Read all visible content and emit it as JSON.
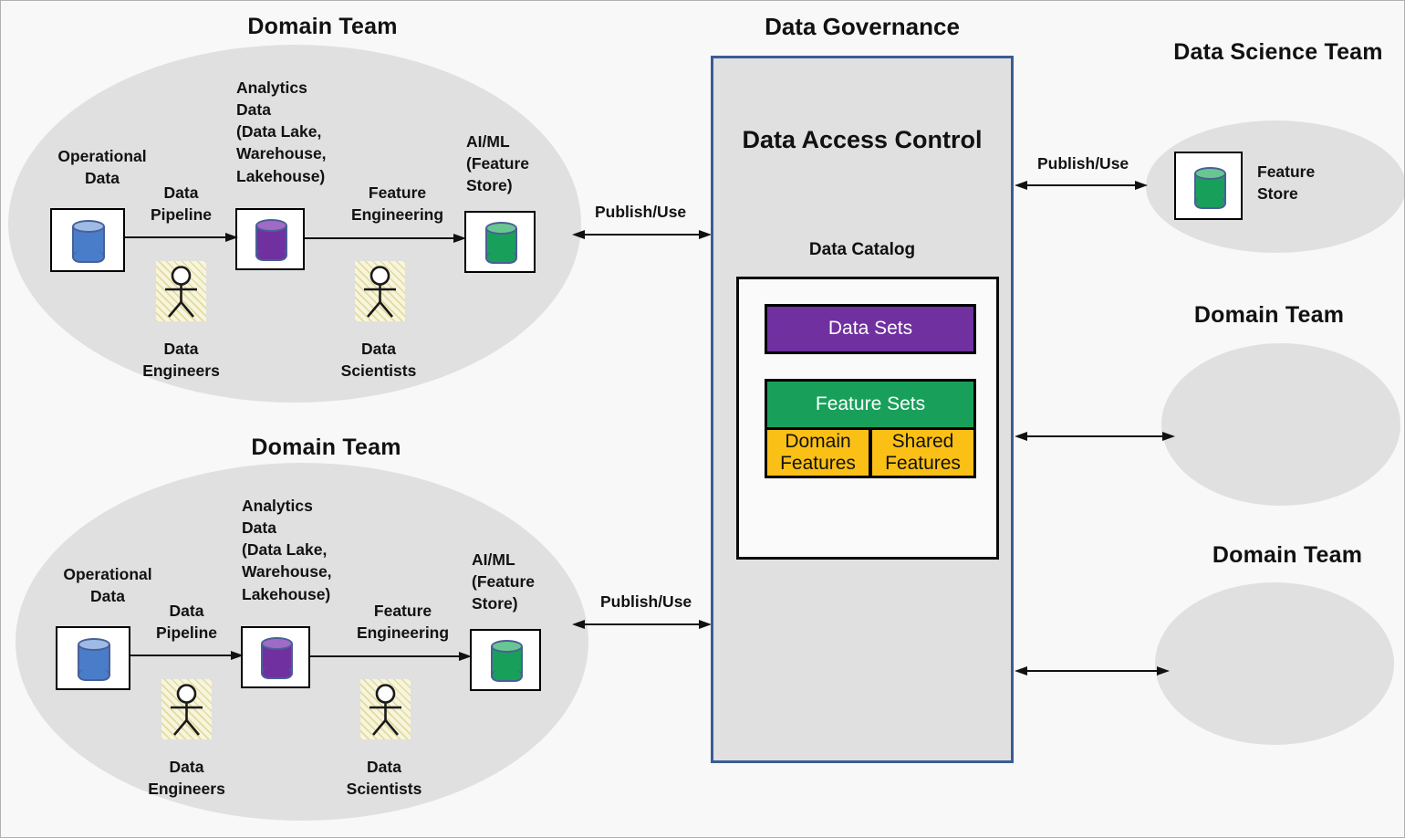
{
  "groups": {
    "domain_team_top": {
      "title": "Domain Team",
      "operational_data": "Operational\nData",
      "analytics_data": "Analytics\nData\n(Data Lake,\nWarehouse,\nLakehouse)",
      "aiml": "AI/ML\n(Feature\nStore)",
      "data_pipeline": "Data\nPipeline",
      "feature_engineering": "Feature\nEngineering",
      "data_engineers": "Data\nEngineers",
      "data_scientists": "Data\nScientists"
    },
    "domain_team_bottom": {
      "title": "Domain Team",
      "operational_data": "Operational\nData",
      "analytics_data": "Analytics\nData\n(Data Lake,\nWarehouse,\nLakehouse)",
      "aiml": "AI/ML\n(Feature\nStore)",
      "data_pipeline": "Data\nPipeline",
      "feature_engineering": "Feature\nEngineering",
      "data_engineers": "Data\nEngineers",
      "data_scientists": "Data\nScientists"
    },
    "data_science_team": {
      "title": "Data Science Team",
      "feature_store": "Feature\nStore"
    },
    "domain_team_right_1": {
      "title": "Domain Team"
    },
    "domain_team_right_2": {
      "title": "Domain Team"
    }
  },
  "governance": {
    "title": "Data Governance",
    "access_control": "Data Access Control",
    "catalog": "Data Catalog",
    "chips": {
      "data_sets": "Data Sets",
      "feature_sets": "Feature Sets",
      "domain_features": "Domain\nFeatures",
      "shared_features": "Shared\nFeatures"
    }
  },
  "connectors": {
    "publish_use_top": "Publish/Use",
    "publish_use_bottom": "Publish/Use",
    "publish_use_ds": "Publish/Use"
  },
  "colors": {
    "operational_db": "#4a7dc9",
    "analytics_db": "#7030a0",
    "feature_db": "#18a05a",
    "db_outline": "#4a5f96",
    "group_fill": "#e0e0e0",
    "panel_border": "#3b5c96",
    "chip_purple": "#7030a0",
    "chip_green": "#18a05a",
    "chip_amber": "#fbc016",
    "canvas_bg": "#f8f8f8"
  },
  "icons": {
    "database": "database-cylinder-icon",
    "person": "stick-figure-person-icon",
    "arrow_right": "arrow-right-icon",
    "arrow_bidirectional": "arrow-bidirectional-icon"
  }
}
